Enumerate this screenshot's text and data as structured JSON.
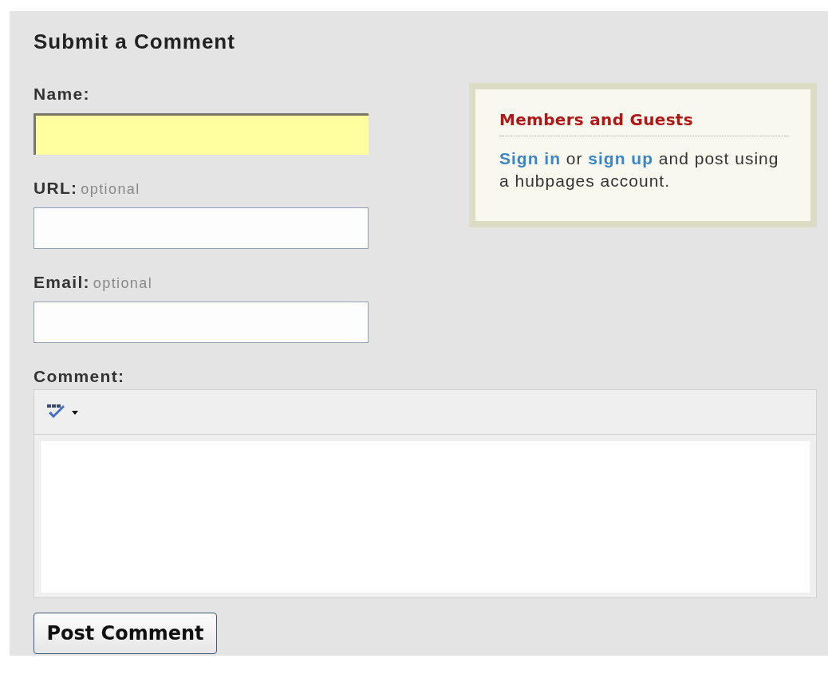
{
  "title": "Submit a Comment",
  "fields": [
    {
      "label": "Name:",
      "focused": true
    },
    {
      "label": "URL:",
      "hint": "optional",
      "focused": false
    },
    {
      "label": "Email:",
      "hint": "optional",
      "focused": false
    }
  ],
  "comment": {
    "label": "Comment:"
  },
  "members_box": {
    "heading": "Members and Guests",
    "prompt": [
      {
        "kind": "link",
        "text": "Sign in"
      },
      {
        "kind": "text",
        "text": " or "
      },
      {
        "kind": "link",
        "text": "sign up"
      },
      {
        "kind": "text",
        "text": " and post using a hubpages account."
      }
    ]
  },
  "submit_button": "Post Comment"
}
